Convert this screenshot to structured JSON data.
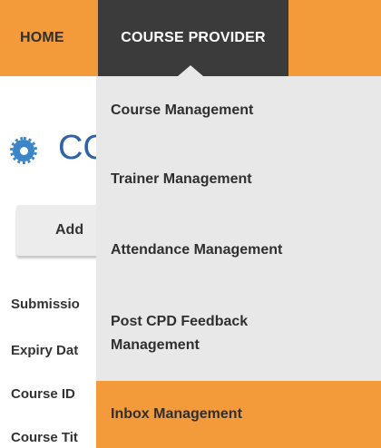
{
  "nav": {
    "home_label": "HOME",
    "course_provider_label": "COURSE PROVIDER"
  },
  "page": {
    "title_partial": "CO",
    "add_button_partial": "Add",
    "field_labels": [
      "Submissio",
      "Expiry Dat",
      "Course ID",
      "Course Tit"
    ]
  },
  "dropdown": {
    "items": [
      {
        "label": "Course Management",
        "active": false
      },
      {
        "label": "Trainer Management",
        "active": false
      },
      {
        "label": "Attendance Management",
        "active": false
      },
      {
        "label": "Post CPD Feedback Management",
        "active": false
      },
      {
        "label": "Inbox Management",
        "active": true
      }
    ]
  },
  "colors": {
    "accent_orange": "#f39a3b",
    "nav_dark": "#3b3b3b",
    "dropdown_bg": "#e8e8e8",
    "title_blue": "#2f63a6"
  }
}
